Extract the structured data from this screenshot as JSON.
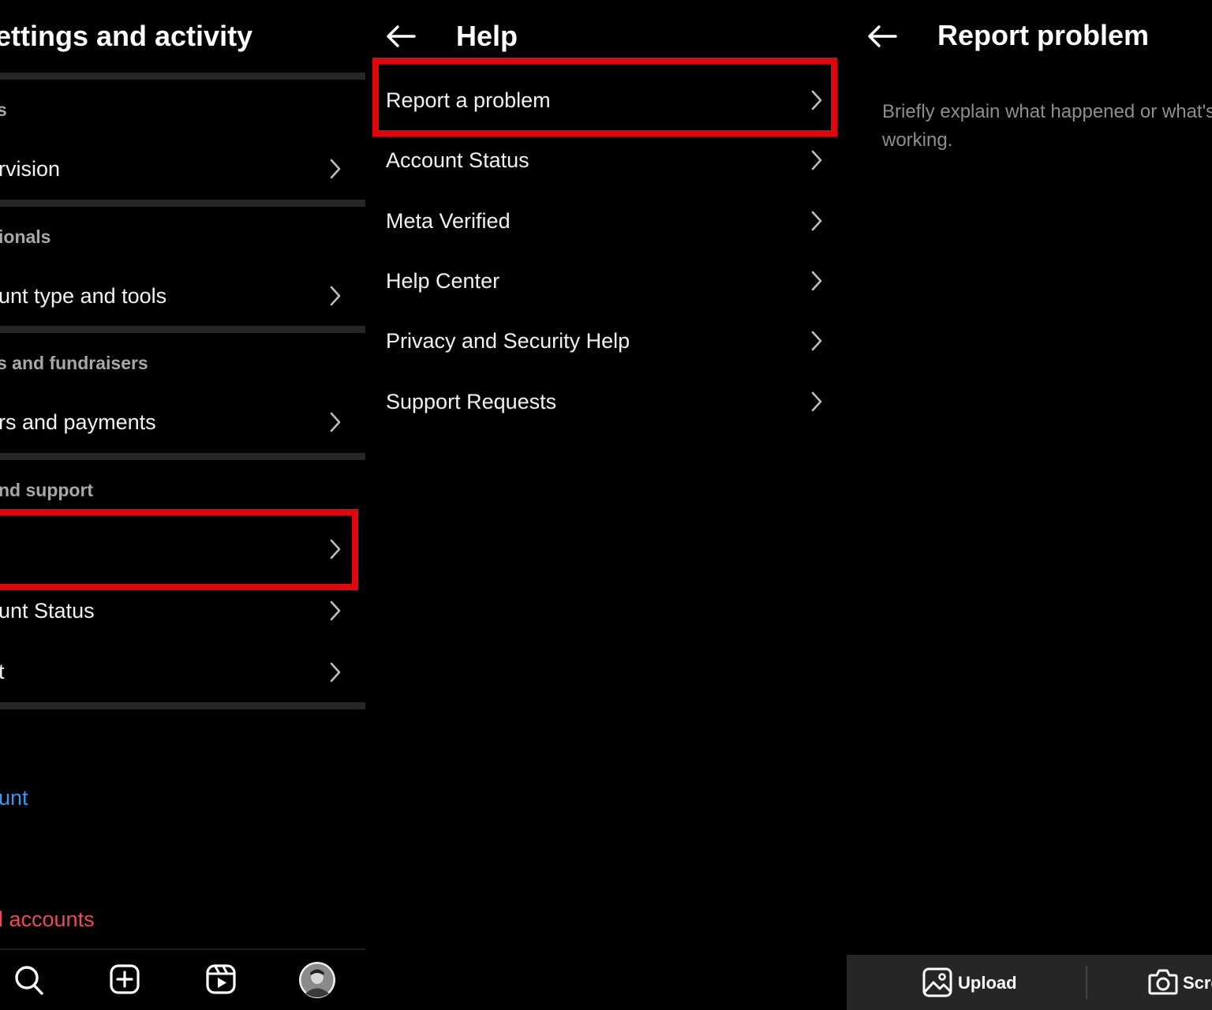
{
  "panel1": {
    "title": "ettings and activity",
    "sections": {
      "s1": "s",
      "s2": "ionals",
      "s3": "s and fundraisers",
      "s4": "nd support"
    },
    "items": {
      "supervision": "rvision",
      "account_type": "unt type and tools",
      "orders": "rs and payments",
      "help": "",
      "account_status": "unt Status",
      "about": "t"
    },
    "links": {
      "add_account": "unt",
      "log_out_all": "l accounts"
    }
  },
  "panel2": {
    "title": "Help",
    "items": [
      "Report a problem",
      "Account Status",
      "Meta Verified",
      "Help Center",
      "Privacy and Security Help",
      "Support Requests"
    ]
  },
  "panel3": {
    "title": "Report problem",
    "description_line1": "Briefly explain what happened or what's",
    "description_line2": "working.",
    "upload_label": "Upload",
    "screenshot_label": "Scre"
  },
  "colors": {
    "highlight": "#e0060b",
    "link_blue": "#3897f0",
    "destructive_red": "#ed4956",
    "divider": "#262626"
  },
  "icons": [
    "back-arrow-icon",
    "chevron-right-icon",
    "search-icon",
    "create-icon",
    "reels-icon",
    "image-icon",
    "camera-icon"
  ]
}
